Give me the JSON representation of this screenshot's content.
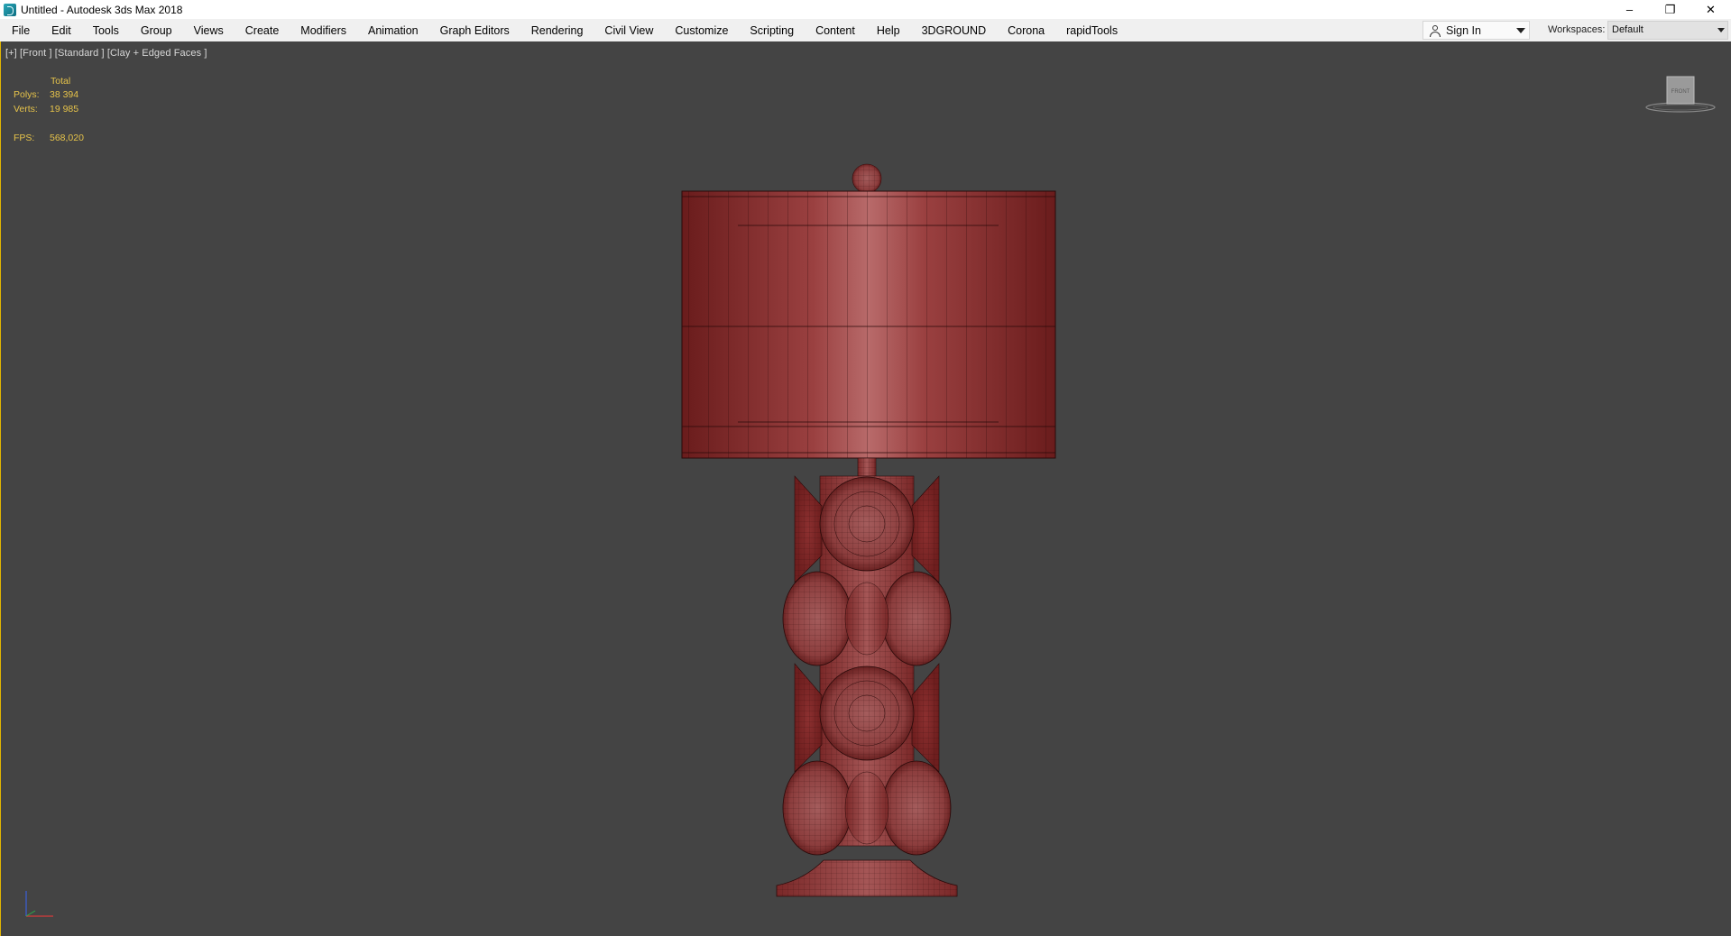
{
  "window": {
    "title": "Untitled - Autodesk 3ds Max 2018",
    "controls": {
      "minimize": "–",
      "restore": "❐",
      "close": "✕"
    }
  },
  "menubar": {
    "items": [
      "File",
      "Edit",
      "Tools",
      "Group",
      "Views",
      "Create",
      "Modifiers",
      "Animation",
      "Graph Editors",
      "Rendering",
      "Civil View",
      "Customize",
      "Scripting",
      "Content",
      "Help",
      "3DGROUND",
      "Corona",
      "rapidTools"
    ],
    "sign_in": "Sign In",
    "workspaces_label": "Workspaces:",
    "workspace_value": "Default"
  },
  "viewport": {
    "label": "[+] [Front ] [Standard ] [Clay + Edged Faces ]",
    "border_color": "#e2b500",
    "stats": {
      "header": "Total",
      "polys_label": "Polys:",
      "polys_value": "38 394",
      "verts_label": "Verts:",
      "verts_value": "19 985",
      "fps_label": "FPS:",
      "fps_value": "568,020"
    },
    "viewcube_label": "FRONT",
    "model_color": "#a03838"
  }
}
